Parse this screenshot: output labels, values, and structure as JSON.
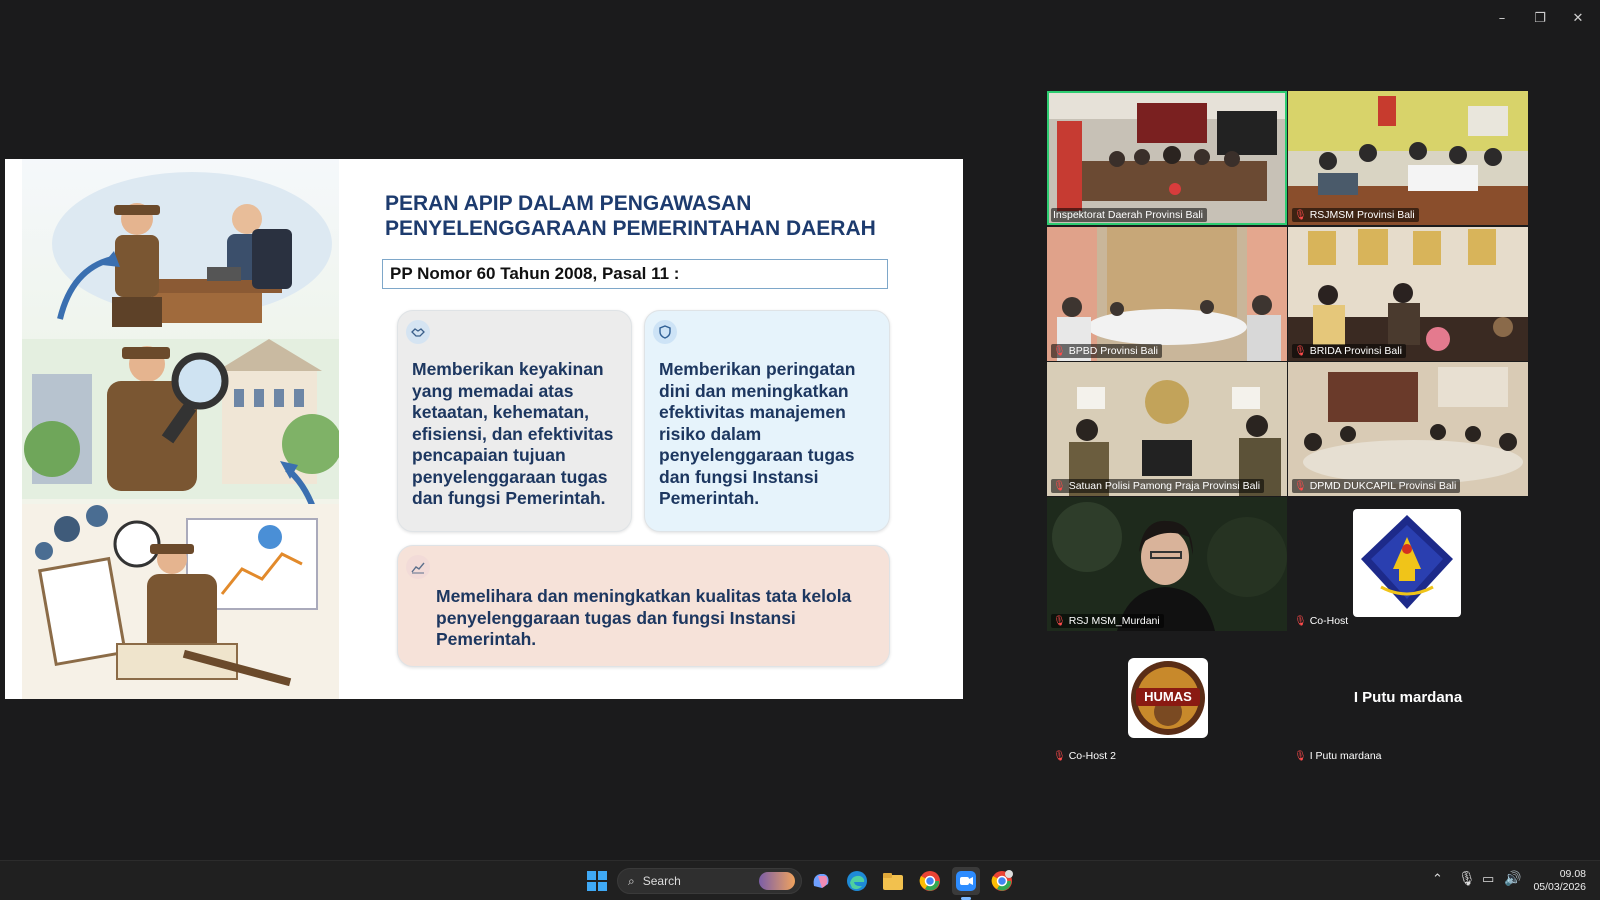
{
  "window": {
    "minimize": "–",
    "restore": "❐",
    "close": "✕"
  },
  "slide": {
    "title": "PERAN APIP DALAM PENGAWASAN PENYELENGGARAAN PEMERINTAHAN DAERAH",
    "subtitle": "PP Nomor 60 Tahun 2008, Pasal 11 :",
    "cards": [
      {
        "icon": "handshake-icon",
        "text": "Memberikan keyakinan yang memadai atas ketaatan, kehematan, efisiensi, dan efektivitas pencapaian tujuan penyelenggaraan tugas dan fungsi Pemerintah."
      },
      {
        "icon": "shield-icon",
        "text": "Memberikan peringatan dini dan meningkatkan efektivitas manajemen risiko dalam penyelenggaraan tugas dan fungsi Instansi Pemerintah."
      },
      {
        "icon": "chart-line-icon",
        "text": "Memelihara dan meningkatkan kualitas tata kelola penyelenggaraan tugas dan fungsi Instansi Pemerintah."
      }
    ]
  },
  "participants": [
    {
      "name": "Inspektorat Daerah Provinsi Bali",
      "muted": false,
      "active": true
    },
    {
      "name": "RSJMSM Provinsi Bali",
      "muted": true
    },
    {
      "name": "BPBD Provinsi Bali",
      "muted": true
    },
    {
      "name": "BRIDA Provinsi Bali",
      "muted": true
    },
    {
      "name": "Satuan Polisi Pamong Praja Provinsi Bali",
      "muted": true
    },
    {
      "name": "DPMD DUKCAPIL Provinsi Bali",
      "muted": true
    },
    {
      "name": "RSJ MSM_Murdani",
      "muted": true
    },
    {
      "name": "Co-Host",
      "muted": true
    },
    {
      "name": "Co-Host 2",
      "muted": true,
      "logo_text": "HUMAS"
    },
    {
      "name": "I Putu mardana",
      "muted": true,
      "display_name": "I Putu mardana"
    }
  ],
  "taskbar": {
    "search_placeholder": "Search",
    "time": "09.08",
    "date": "05/03/2026"
  }
}
